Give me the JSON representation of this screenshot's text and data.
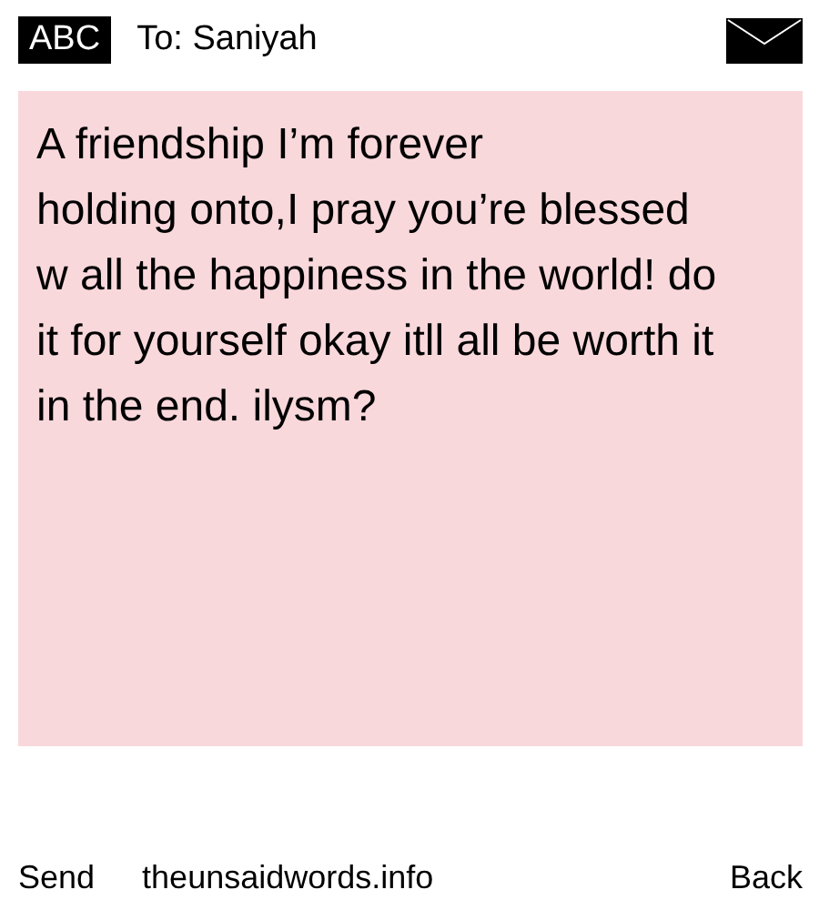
{
  "header": {
    "mode": "ABC",
    "recipient": "To: Saniyah"
  },
  "message": "A friendship I’m forever\nholding onto,I pray you’re blessed w all the happiness in the world! do it for yourself okay itll all be worth it in the end. ilysm?",
  "footer": {
    "left": "Send",
    "center": "theunsaidwords.info",
    "right": "Back"
  }
}
